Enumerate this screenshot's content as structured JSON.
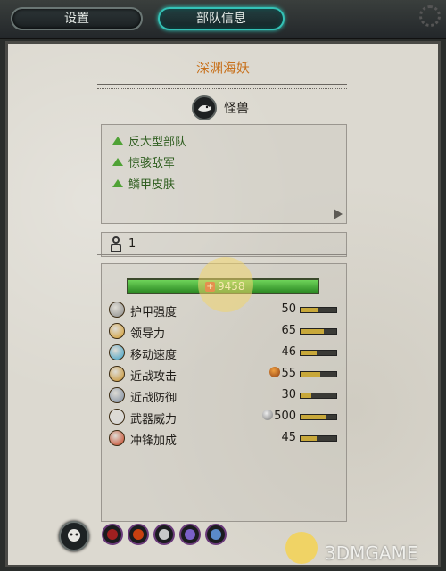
{
  "tabs": [
    {
      "label": "设置"
    },
    {
      "label": "部队信息"
    }
  ],
  "unit": {
    "name": "深渊海妖",
    "category": "怪兽",
    "category_icon": "monster-icon"
  },
  "attributes": [
    {
      "label": "反大型部队",
      "icon": "up-triangle-icon"
    },
    {
      "label": "惊骇敌军",
      "icon": "up-triangle-icon"
    },
    {
      "label": "鳞甲皮肤",
      "icon": "up-triangle-icon"
    }
  ],
  "men_count": "1",
  "hp": "9458",
  "stats": [
    {
      "label": "护甲强度",
      "value": "50",
      "fill": 0.5,
      "icon": "armor-icon",
      "color": "#8a8a88"
    },
    {
      "label": "领导力",
      "value": "65",
      "fill": 0.65,
      "icon": "leadership-icon",
      "color": "#d39a28"
    },
    {
      "label": "移动速度",
      "value": "46",
      "fill": 0.46,
      "icon": "speed-icon",
      "color": "#3aa0c8"
    },
    {
      "label": "近战攻击",
      "value": "55",
      "fill": 0.55,
      "icon": "melee-attack-icon",
      "color": "#c89028",
      "prefix_icon": "fire-damage-icon"
    },
    {
      "label": "近战防御",
      "value": "30",
      "fill": 0.3,
      "icon": "melee-defence-icon",
      "color": "#7a8aa0"
    },
    {
      "label": "武器威力",
      "value": "500",
      "fill": 0.7,
      "icon": "weapon-strength-icon",
      "color": "#d8d8d8",
      "prefix_icon": "armor-piercing-icon"
    },
    {
      "label": "冲锋加成",
      "value": "45",
      "fill": 0.45,
      "icon": "charge-bonus-icon",
      "color": "#c84020"
    }
  ],
  "ability_icons": [
    {
      "icon": "ability-icon-1",
      "color": "#a02020"
    },
    {
      "icon": "ability-icon-2",
      "color": "#c84010"
    },
    {
      "icon": "ability-icon-3",
      "color": "#c8c8c8"
    },
    {
      "icon": "ability-icon-4",
      "color": "#7a60c8"
    },
    {
      "icon": "ability-icon-5",
      "color": "#5a8ac8"
    }
  ],
  "watermark": "3DMGAME"
}
